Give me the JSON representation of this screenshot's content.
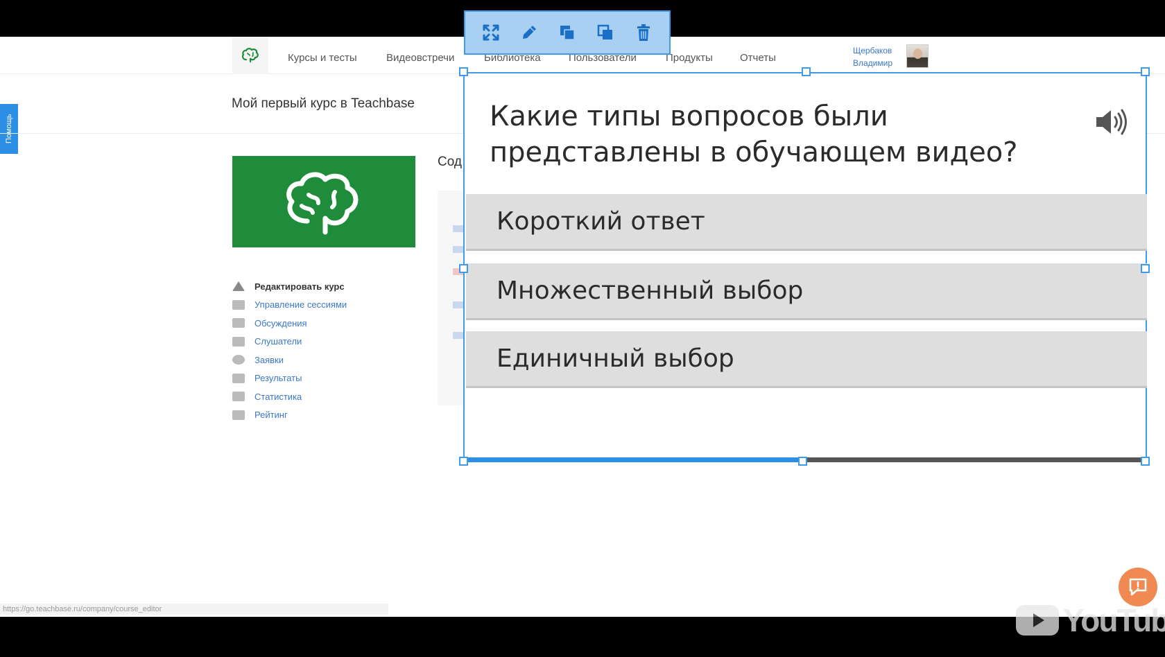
{
  "nav": {
    "items": [
      "Курсы и тесты",
      "Видеовстречи",
      "Библиотека",
      "Пользователи",
      "Продукты",
      "Отчеты"
    ],
    "user_name": "Щербаков Владимир"
  },
  "help_tab": "Помощь",
  "course": {
    "title": "Мой первый курс в Teachbase",
    "content_heading": "Сод",
    "menu": [
      {
        "label": "Редактировать курс",
        "icon": "home-icon"
      },
      {
        "label": "Управление сессиями",
        "icon": "table-icon"
      },
      {
        "label": "Обсуждения",
        "icon": "chat-icon"
      },
      {
        "label": "Слушатели",
        "icon": "user-icon"
      },
      {
        "label": "Заявки",
        "icon": "clock-icon"
      },
      {
        "label": "Результаты",
        "icon": "results-icon"
      },
      {
        "label": "Статистика",
        "icon": "chart-icon"
      },
      {
        "label": "Рейтинг",
        "icon": "trophy-icon"
      }
    ]
  },
  "quiz": {
    "question": "Какие типы вопросов были представлены в обучающем видео?",
    "answers": [
      "Короткий ответ",
      "Множественный выбор",
      "Единичный выбор"
    ],
    "progress": 0.49
  },
  "toolbar": {
    "buttons": [
      "expand-icon",
      "pencil-icon",
      "bring-front-icon",
      "send-back-icon",
      "trash-icon"
    ]
  },
  "status_url": "https://go.teachbase.ru/company/course_editor",
  "watermark": "YouTube",
  "colors": {
    "accent": "#2d8ee6",
    "brand_green": "#1f8c3c",
    "chat_orange": "#f08a52"
  }
}
